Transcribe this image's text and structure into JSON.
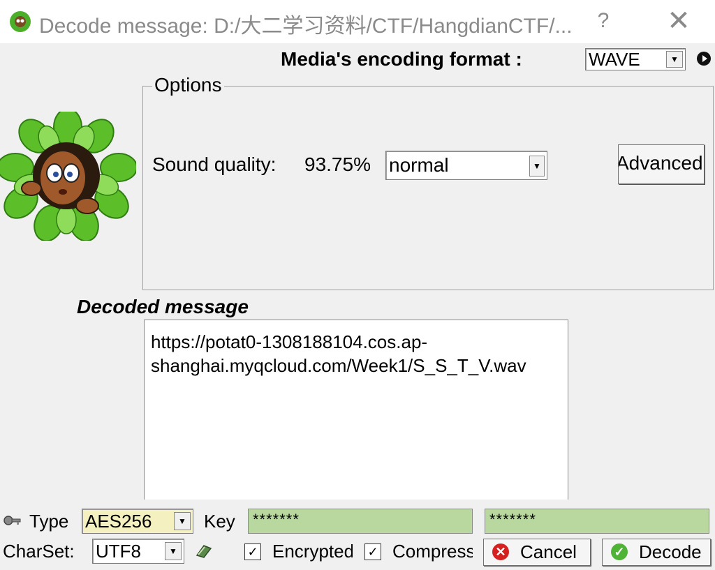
{
  "window": {
    "title": "Decode message: D:/大二学习资料/CTF/HangdianCTF/...",
    "help_label": "?",
    "close_label": "✕"
  },
  "format": {
    "label": "Media's encoding format :",
    "value": "WAVE"
  },
  "options": {
    "legend": "Options",
    "sound_quality_label": "Sound quality:",
    "sound_quality_value": "93.75%",
    "quality_select": "normal",
    "advanced_label": "Advanced"
  },
  "decoded": {
    "label": "Decoded message",
    "text": "https://potat0-1308188104.cos.ap-\nshanghai.myqcloud.com/Week1/S_S_T_V.wav"
  },
  "bottom": {
    "type_label": "Type",
    "type_value": "AES256",
    "key_label": "Key",
    "key1": "*******",
    "key2": "*******",
    "charset_label": "CharSet:",
    "charset_value": "UTF8",
    "encrypted_label": "Encrypted",
    "compressed_label": "Compressed",
    "encrypted_checked": true,
    "compressed_checked": true,
    "cancel_label": "Cancel",
    "decode_label": "Decode"
  },
  "colors": {
    "key_field_bg": "#b8d8a0",
    "type_field_bg": "#f5f0bf",
    "cancel_icon": "#d62020",
    "decode_icon": "#4fb336"
  }
}
